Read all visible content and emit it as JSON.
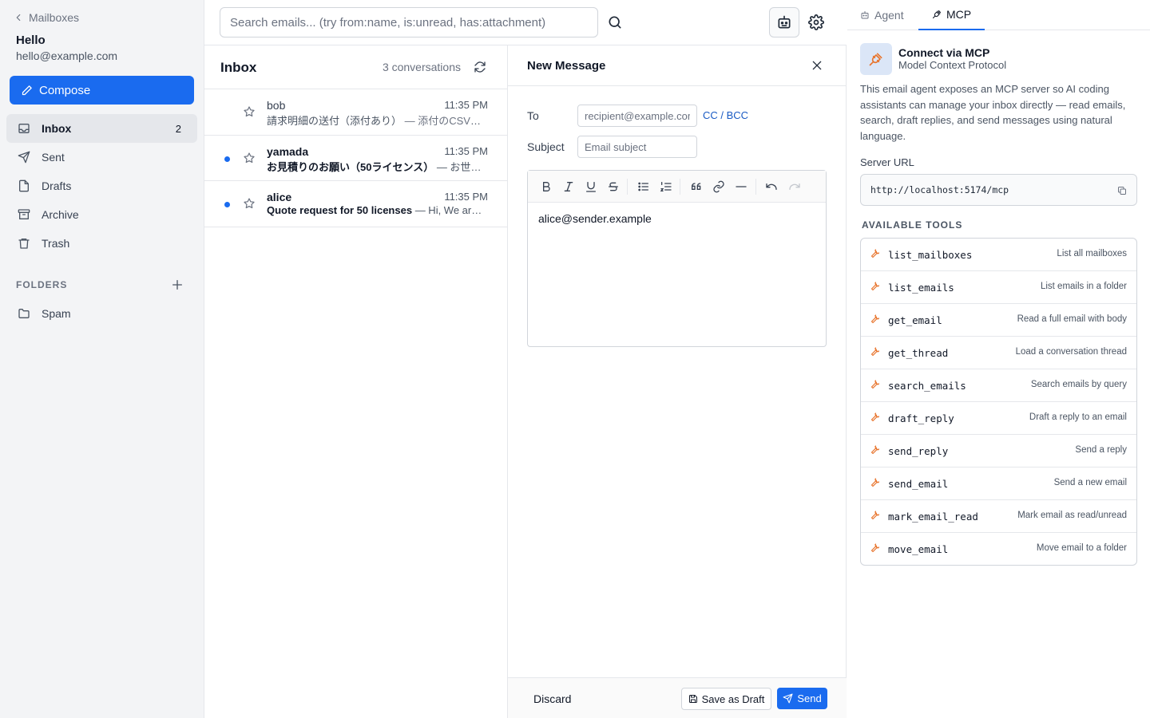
{
  "sidebar": {
    "back_label": "Mailboxes",
    "account_name": "Hello",
    "account_email": "hello@example.com",
    "compose_label": "Compose",
    "nav": [
      {
        "label": "Inbox",
        "count": "2",
        "icon": "inbox-icon"
      },
      {
        "label": "Sent",
        "icon": "send-icon"
      },
      {
        "label": "Drafts",
        "icon": "file-icon"
      },
      {
        "label": "Archive",
        "icon": "archive-icon"
      },
      {
        "label": "Trash",
        "icon": "trash-icon"
      }
    ],
    "folders_heading": "FOLDERS",
    "folders": [
      {
        "label": "Spam",
        "icon": "folder-icon"
      }
    ]
  },
  "search": {
    "placeholder": "Search emails... (try from:name, is:unread, has:attachment)",
    "value": ""
  },
  "inbox": {
    "title": "Inbox",
    "count_label": "3 conversations",
    "emails": [
      {
        "from": "bob",
        "time": "11:35 PM",
        "subject": "請求明細の送付（添付あり）",
        "snippet": " — 添付のCSVに請求明細をまとめました",
        "unread": false
      },
      {
        "from": "yamada",
        "time": "11:35 PM",
        "subject": "お見積りのお願い（50ライセンス）",
        "snippet": " — お世話になっております",
        "unread": true
      },
      {
        "from": "alice",
        "time": "11:35 PM",
        "subject": "Quote request for 50 licenses",
        "snippet": " — Hi, We are interested in your product",
        "unread": true
      }
    ]
  },
  "compose": {
    "title": "New Message",
    "to_label": "To",
    "to_placeholder": "recipient@example.com",
    "to_value": "",
    "cc_bcc_label": "CC / BCC",
    "subject_label": "Subject",
    "subject_placeholder": "Email subject",
    "subject_value": "",
    "body": "alice@sender.example",
    "discard_label": "Discard",
    "save_draft_label": "Save as Draft",
    "send_label": "Send"
  },
  "panel": {
    "tabs": [
      {
        "label": "Agent",
        "active": false,
        "icon": "bot-icon"
      },
      {
        "label": "MCP",
        "active": true,
        "icon": "plug-icon"
      }
    ],
    "mcp_title": "Connect via MCP",
    "mcp_subtitle": "Model Context Protocol",
    "description": "This email agent exposes an MCP server so AI coding assistants can manage your inbox directly — read emails, search, draft replies, and send messages using natural language.",
    "server_label": "Server URL",
    "server_url": "http://localhost:5174/mcp",
    "tools_heading": "AVAILABLE TOOLS",
    "tools": [
      {
        "name": "list_mailboxes",
        "desc": "List all mailboxes"
      },
      {
        "name": "list_emails",
        "desc": "List emails in a folder"
      },
      {
        "name": "get_email",
        "desc": "Read a full email with body"
      },
      {
        "name": "get_thread",
        "desc": "Load a conversation thread"
      },
      {
        "name": "search_emails",
        "desc": "Search emails by query"
      },
      {
        "name": "draft_reply",
        "desc": "Draft a reply to an email"
      },
      {
        "name": "send_reply",
        "desc": "Send a reply"
      },
      {
        "name": "send_email",
        "desc": "Send a new email"
      },
      {
        "name": "mark_email_read",
        "desc": "Mark email as read/unread"
      },
      {
        "name": "move_email",
        "desc": "Move email to a folder"
      }
    ]
  },
  "colors": {
    "accent": "#1a6bef",
    "tool_icon": "#e8742c",
    "link": "#1a5bc4"
  }
}
